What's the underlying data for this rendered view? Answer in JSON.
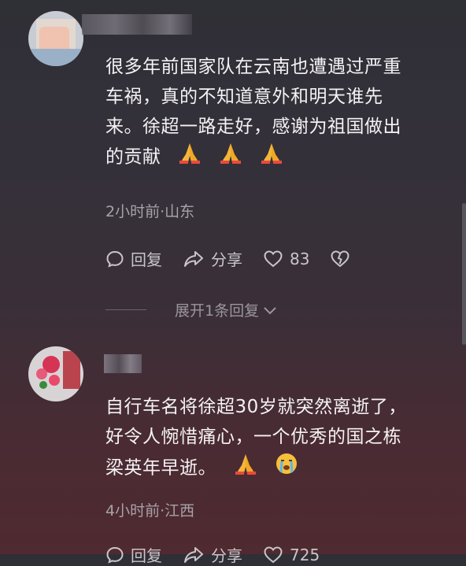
{
  "comments": [
    {
      "text_lines": [
        "很多年前国家队在云南也遭遇过严重",
        "车祸，真的不知道意外和明天谁先",
        "来。徐超一路走好，感谢为祖国做出",
        "的贡献"
      ],
      "emojis": [
        "praying-hands",
        "praying-hands",
        "praying-hands"
      ],
      "meta": "2小时前·山东",
      "reply_label": "回复",
      "share_label": "分享",
      "like_count": "83",
      "expand_label": "展开1条回复"
    },
    {
      "text_lines": [
        "自行车名将徐超30岁就突然离逝了，",
        "好令人惋惜痛心，一个优秀的国之栋",
        "梁英年早逝。"
      ],
      "emojis": [
        "praying-hands",
        "crying-face"
      ],
      "meta": "4小时前·江西",
      "reply_label": "回复",
      "share_label": "分享",
      "like_count": "725"
    }
  ],
  "colors": {
    "text": "#f4f2f4",
    "meta": "#a7a2a8",
    "emoji_gold": "#f4b63a"
  }
}
